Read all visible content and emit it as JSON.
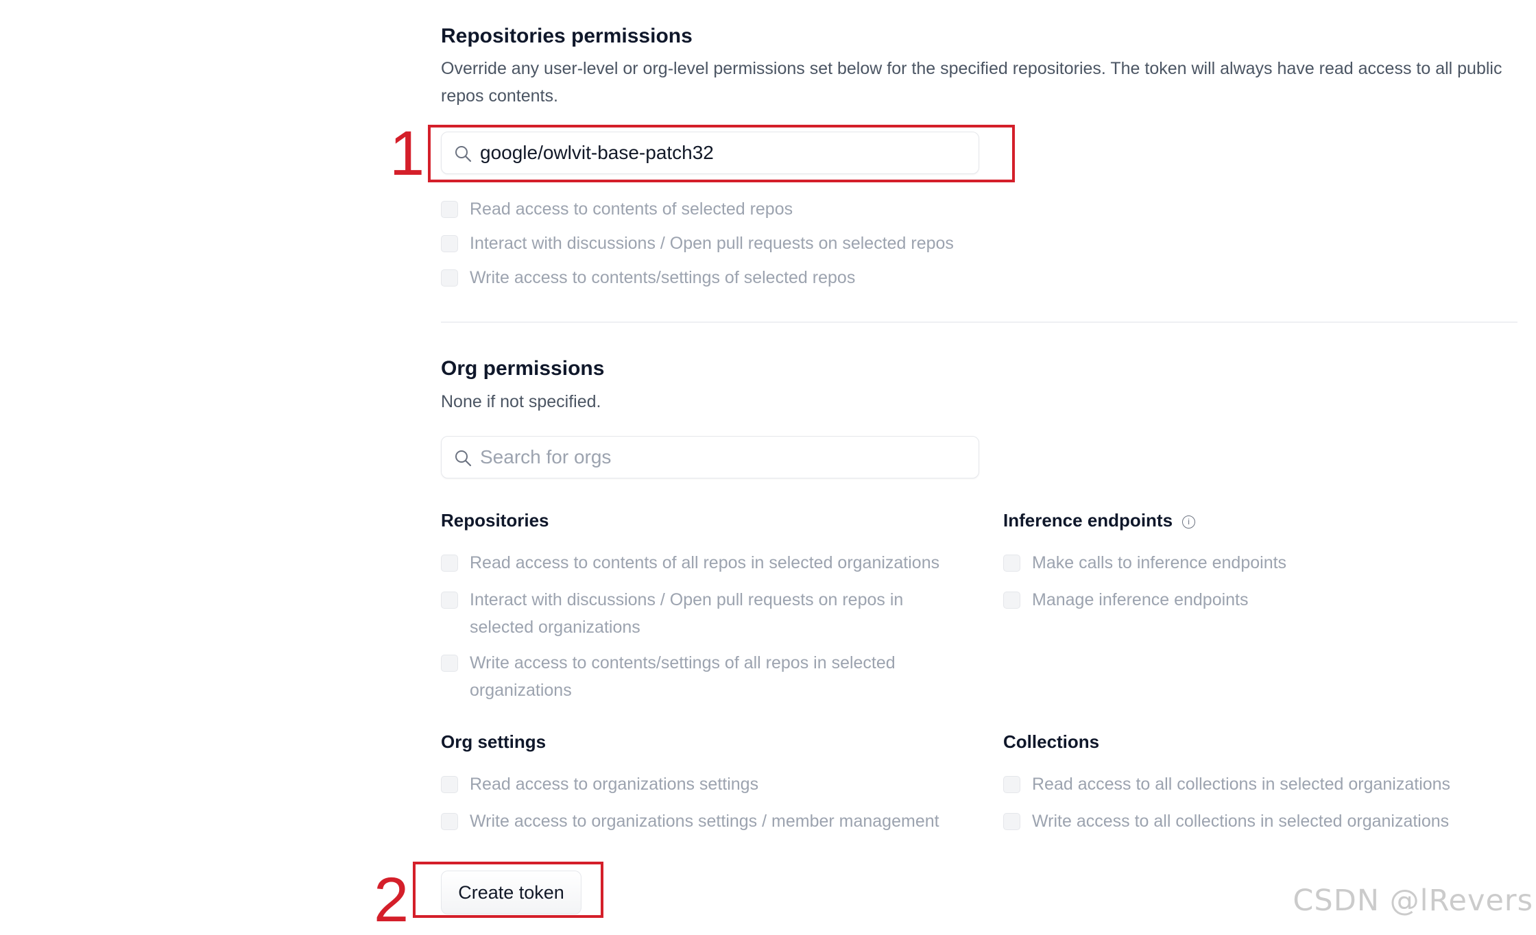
{
  "repo_permissions": {
    "title": "Repositories permissions",
    "description": "Override any user-level or org-level permissions set below for the specified repositories. The token will always have read access to all public repos contents.",
    "search_value": "google/owlvit-base-patch32",
    "options": [
      "Read access to contents of selected repos",
      "Interact with discussions / Open pull requests on selected repos",
      "Write access to contents/settings of selected repos"
    ]
  },
  "org_permissions": {
    "title": "Org permissions",
    "description": "None if not specified.",
    "search_placeholder": "Search for orgs",
    "repositories": {
      "title": "Repositories",
      "options": [
        "Read access to contents of all repos in selected organizations",
        "Interact with discussions / Open pull requests on repos in selected organizations",
        "Write access to contents/settings of all repos in selected organizations"
      ]
    },
    "inference_endpoints": {
      "title": "Inference endpoints",
      "options": [
        "Make calls to inference endpoints",
        "Manage inference endpoints"
      ]
    },
    "org_settings": {
      "title": "Org settings",
      "options": [
        "Read access to organizations settings",
        "Write access to organizations settings / member management"
      ]
    },
    "collections": {
      "title": "Collections",
      "options": [
        "Read access to all collections in selected organizations",
        "Write access to all collections in selected organizations"
      ]
    }
  },
  "create_button": "Create token",
  "annotations": {
    "marker_1": "1",
    "marker_2": "2",
    "color": "#d41f2a"
  },
  "watermark": "CSDN @lRevers"
}
